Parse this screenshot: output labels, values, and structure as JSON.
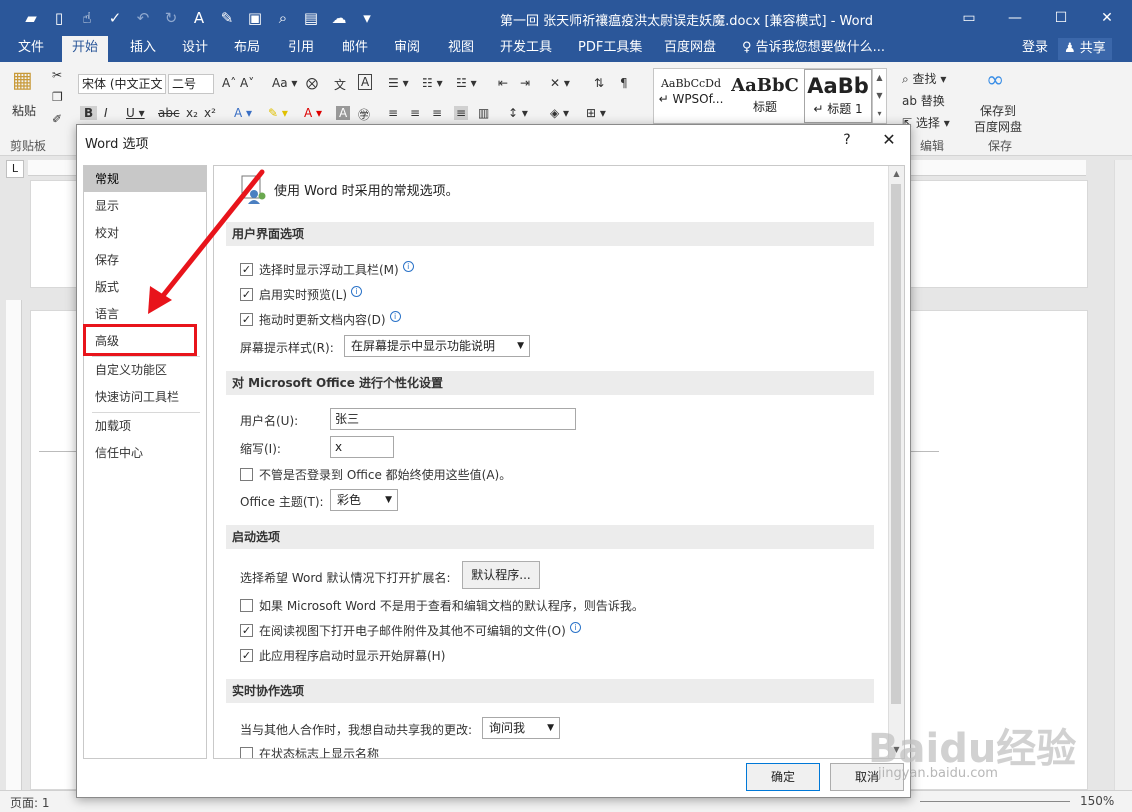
{
  "window": {
    "title": "第一回 张天师祈禳瘟疫洪太尉误走妖魔.docx [兼容模式] - Word"
  },
  "ribbon_tabs": [
    {
      "label": "文件"
    },
    {
      "label": "开始"
    },
    {
      "label": "插入"
    },
    {
      "label": "设计"
    },
    {
      "label": "布局"
    },
    {
      "label": "引用"
    },
    {
      "label": "邮件"
    },
    {
      "label": "审阅"
    },
    {
      "label": "视图"
    },
    {
      "label": "开发工具"
    },
    {
      "label": "PDF工具集"
    },
    {
      "label": "百度网盘"
    }
  ],
  "tell_me": "告诉我您想要做什么...",
  "login": "登录",
  "share": "共享",
  "ribbon": {
    "paste": "粘贴",
    "font_name": "宋体 (中文正文",
    "font_size": "二号",
    "style_normal_preview": "AaBbCcDd",
    "style_normal_name": "WPSOf...",
    "style_title_preview": "AaBbC",
    "style_title_name": "标题",
    "style_heading1_preview": "AaBb",
    "style_heading1_name": "标题 1",
    "find": "查找",
    "replace": "替换",
    "select": "选择",
    "save_to_baidu": "保存到",
    "save_to_baidu2": "百度网盘",
    "group_clipboard": "剪贴板",
    "group_edit": "编辑",
    "group_save": "保存"
  },
  "status": {
    "page": "页面: 1",
    "zoom": "150%"
  },
  "dialog": {
    "title": "Word 选项",
    "help": "?",
    "close": "✕",
    "nav": [
      {
        "label": "常规"
      },
      {
        "label": "显示"
      },
      {
        "label": "校对"
      },
      {
        "label": "保存"
      },
      {
        "label": "版式"
      },
      {
        "label": "语言"
      },
      {
        "label": "高级"
      },
      {
        "label": "自定义功能区"
      },
      {
        "label": "快速访问工具栏"
      },
      {
        "label": "加载项"
      },
      {
        "label": "信任中心"
      }
    ],
    "header": "使用 Word 时采用的常规选项。",
    "sections": {
      "ui": "用户界面选项",
      "personalize": "对 Microsoft Office 进行个性化设置",
      "startup": "启动选项",
      "collab": "实时协作选项"
    },
    "ui_options": {
      "mini_toolbar": "选择时显示浮动工具栏(M)",
      "live_preview": "启用实时预览(L)",
      "update_drag": "拖动时更新文档内容(D)",
      "screentip_label": "屏幕提示样式(R):",
      "screentip_value": "在屏幕提示中显示功能说明"
    },
    "personal": {
      "username_label": "用户名(U):",
      "username_value": "张三",
      "initials_label": "缩写(I):",
      "initials_value": "x",
      "always_use": "不管是否登录到 Office 都始终使用这些值(A)。",
      "theme_label": "Office 主题(T):",
      "theme_value": "彩色"
    },
    "startup_opts": {
      "default_ext_label": "选择希望 Word 默认情况下打开扩展名:",
      "default_programs": "默认程序...",
      "tell_default": "如果 Microsoft Word 不是用于查看和编辑文档的默认程序，则告诉我。",
      "reading_view": "在阅读视图下打开电子邮件附件及其他不可编辑的文件(O)",
      "start_screen": "此应用程序启动时显示开始屏幕(H)"
    },
    "collab_opts": {
      "share_label": "当与其他人合作时，我想自动共享我的更改:",
      "share_value": "询问我",
      "show_names": "在状态标志上显示名称"
    },
    "ok": "确定",
    "cancel": "取消"
  },
  "watermark": {
    "text": "Baidu经验",
    "url": "jingyan.baidu.com"
  },
  "colors": {
    "word_blue": "#2b579a",
    "highlight_red": "#e8141b"
  }
}
